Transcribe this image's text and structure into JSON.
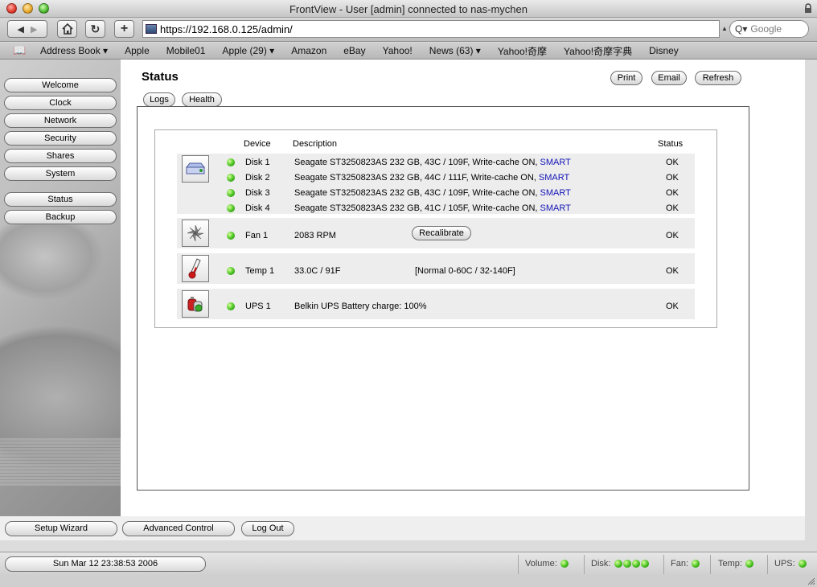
{
  "window": {
    "title": "FrontView - User [admin] connected to nas-mychen"
  },
  "toolbar": {
    "url": "https://192.168.0.125/admin/",
    "search_placeholder": "Google"
  },
  "bookmarks": [
    "Address Book ▾",
    "Apple",
    "Mobile01",
    "Apple (29) ▾",
    "Amazon",
    "eBay",
    "Yahoo!",
    "News (63) ▾",
    "Yahoo!奇摩",
    "Yahoo!奇摩字典",
    "Disney"
  ],
  "sidebar": {
    "items": [
      "Welcome",
      "Clock",
      "Network",
      "Security",
      "Shares",
      "System"
    ],
    "items2": [
      "Status",
      "Backup"
    ]
  },
  "page": {
    "title": "Status",
    "actions": {
      "print": "Print",
      "email": "Email",
      "refresh": "Refresh"
    },
    "tabs": {
      "logs": "Logs",
      "health": "Health"
    }
  },
  "table": {
    "headers": {
      "device": "Device",
      "description": "Description",
      "status": "Status"
    },
    "disks": [
      {
        "device": "Disk 1",
        "description": "Seagate ST3250823AS 232 GB, 43C / 109F, Write-cache ON,",
        "link": "SMART",
        "status": "OK"
      },
      {
        "device": "Disk 2",
        "description": "Seagate ST3250823AS 232 GB, 44C / 111F, Write-cache ON,",
        "link": "SMART",
        "status": "OK"
      },
      {
        "device": "Disk 3",
        "description": "Seagate ST3250823AS 232 GB, 43C / 109F, Write-cache ON,",
        "link": "SMART",
        "status": "OK"
      },
      {
        "device": "Disk 4",
        "description": "Seagate ST3250823AS 232 GB, 41C / 105F, Write-cache ON,",
        "link": "SMART",
        "status": "OK"
      }
    ],
    "fan": {
      "device": "Fan 1",
      "description": "2083 RPM",
      "button": "Recalibrate",
      "status": "OK"
    },
    "temp": {
      "device": "Temp 1",
      "description": "33.0C / 91F",
      "range": "[Normal 0-60C / 32-140F]",
      "status": "OK"
    },
    "ups": {
      "device": "UPS 1",
      "description": "Belkin UPS Battery charge: 100%",
      "status": "OK"
    }
  },
  "bottom": {
    "setup": "Setup Wizard",
    "advanced": "Advanced Control",
    "logout": "Log Out"
  },
  "statusbar": {
    "datetime": "Sun Mar 12 23:38:53 2006",
    "volume": "Volume:",
    "disk": "Disk:",
    "fan": "Fan:",
    "temp": "Temp:",
    "ups": "UPS:"
  },
  "colors": {
    "led_green": "#46c01e",
    "link_blue": "#1414b8"
  }
}
